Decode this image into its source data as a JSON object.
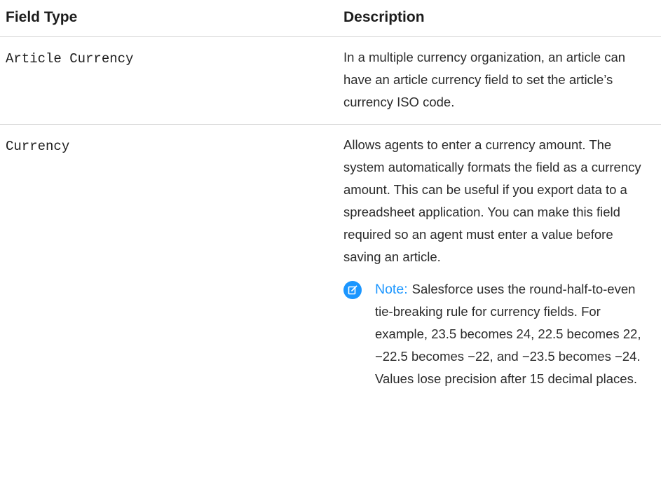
{
  "header": {
    "field_type": "Field Type",
    "description": "Description"
  },
  "rows": [
    {
      "type": "Article Currency",
      "description": "In a multiple currency organization, an article can have an article currency field to set the article’s currency ISO code."
    },
    {
      "type": "Currency",
      "description": "Allows agents to enter a currency amount. The system automatically formats the field as a currency amount. This can be useful if you export data to a spreadsheet application. You can make this field required so an agent must enter a value before saving an article.",
      "note": {
        "label": "Note:",
        "text": "Salesforce uses the round-half-to-even tie-breaking rule for currency fields. For example, 23.5 becomes 24, 22.5 becomes 22, −22.5 becomes −22, and −23.5 becomes −24.",
        "extra": "Values lose precision after 15 decimal places.",
        "icon": "edit-note-icon"
      }
    }
  ],
  "colors": {
    "accent": "#1b96ff",
    "divider": "#d6d6d6",
    "text": "#1c1c1c"
  }
}
